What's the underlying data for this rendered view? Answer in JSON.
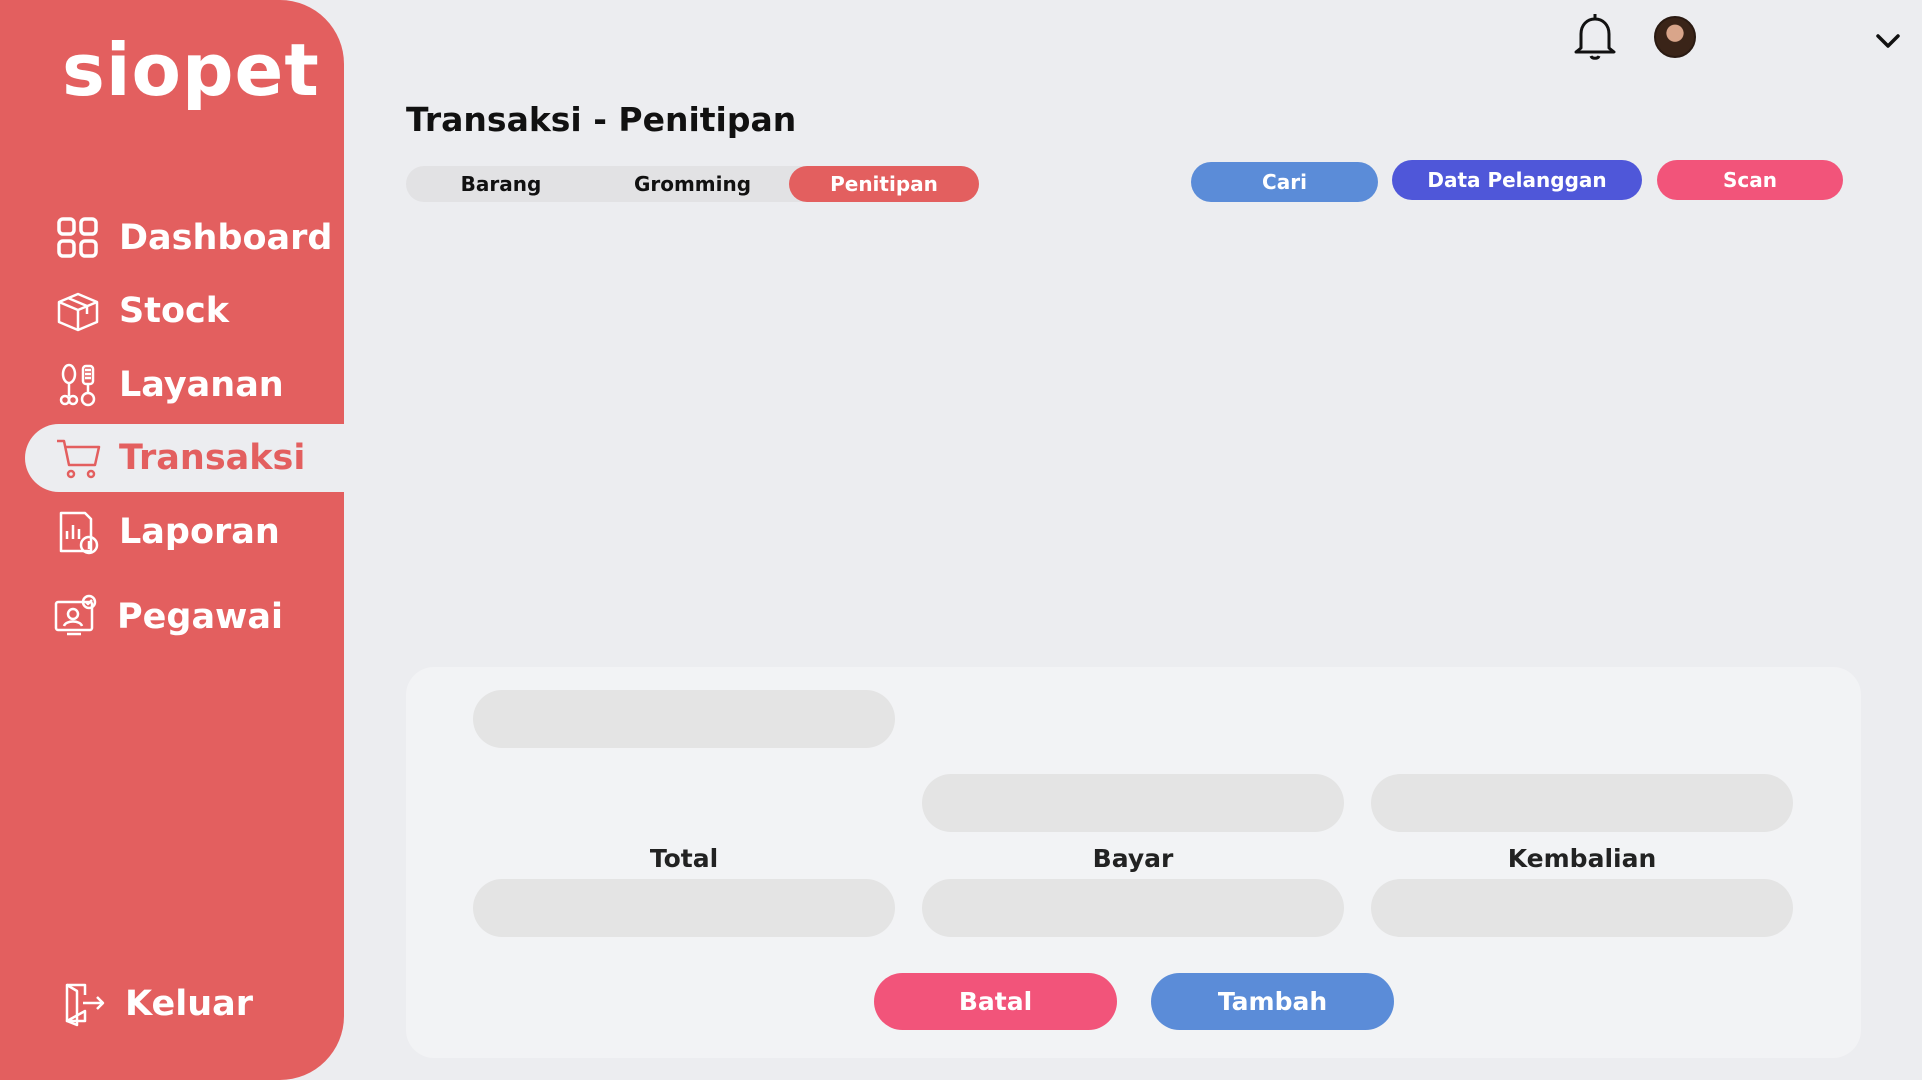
{
  "app": {
    "name": "siopet"
  },
  "sidebar": {
    "items": [
      {
        "label": "Dashboard",
        "icon": "dashboard-grid-icon"
      },
      {
        "label": "Stock",
        "icon": "box-icon"
      },
      {
        "label": "Layanan",
        "icon": "grooming-tools-icon"
      },
      {
        "label": "Transaksi",
        "icon": "shopping-cart-icon",
        "active": true
      },
      {
        "label": "Laporan",
        "icon": "report-icon"
      },
      {
        "label": "Pegawai",
        "icon": "employee-icon"
      }
    ],
    "logout": {
      "label": "Keluar",
      "icon": "logout-door-icon"
    }
  },
  "header": {
    "notification_icon": "bell-icon",
    "avatar": "user-avatar",
    "menu_icon": "chevron-down-icon"
  },
  "page": {
    "title": "Transaksi - Penitipan"
  },
  "tabs": [
    {
      "label": "Barang"
    },
    {
      "label": "Gromming"
    },
    {
      "label": "Penitipan",
      "active": true
    }
  ],
  "actions": {
    "cari": "Cari",
    "data_pelanggan": "Data Pelanggan",
    "scan": "Scan"
  },
  "form": {
    "total_label": "Total",
    "bayar_label": "Bayar",
    "kembalian_label": "Kembalian",
    "batal": "Batal",
    "tambah": "Tambah"
  },
  "colors": {
    "sidebar": "#E35F5F",
    "background": "#ECEDF0",
    "blue_button": "#5B8CD8",
    "indigo_button": "#4F57D9",
    "pink_button": "#F2547A",
    "field": "#E4E4E4"
  }
}
